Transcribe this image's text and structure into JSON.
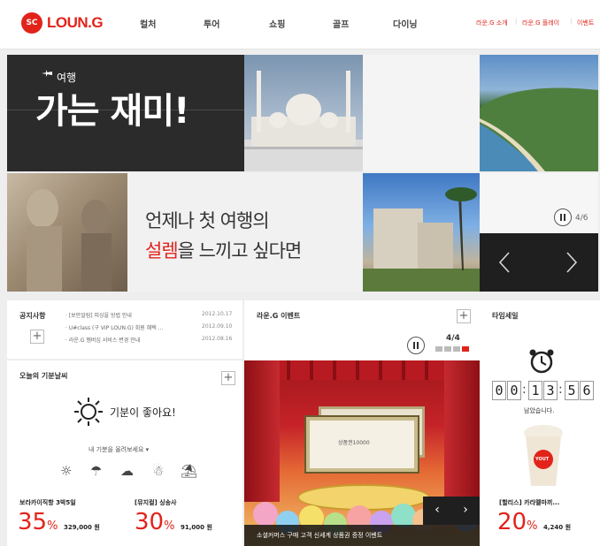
{
  "brand": {
    "logo_mark": "SC",
    "logo_text": "LOUN.G",
    "accent": "#e2231a"
  },
  "nav": [
    "컬처",
    "투어",
    "쇼핑",
    "골프",
    "다이닝"
  ],
  "util_links": [
    "라운.G 소개",
    "라운.G 플레이",
    "이벤트"
  ],
  "hero": {
    "travel_label": "여행",
    "headline": "가는 재미!",
    "line1": "언제나 첫 여행의",
    "line2_accent": "설렘",
    "line2_rest": "을 느끼고 싶다면",
    "counter": "4/6"
  },
  "notice": {
    "title": "공지사항",
    "items": [
      {
        "text": "· [보안알림] 피싱을 방법 안내",
        "date": "2012.10.17"
      },
      {
        "text": "· U#class (구 VIP LOUN.G) 회원 혜택 ...",
        "date": "2012.09.10"
      },
      {
        "text": "· 라운.G 멤버십 서비스 변경 안내",
        "date": "2012.08.16"
      }
    ]
  },
  "event": {
    "title": "라운.G 이벤트",
    "counter": "4/4",
    "ticket_text": "상품권10000",
    "caption": "소셜커머스 구매 고객 신세계 상품권 증정 이벤트"
  },
  "timesale": {
    "title": "타임세일",
    "digits": [
      "0",
      "0",
      "1",
      "3",
      "5",
      "6"
    ],
    "remain": "남았습니다.",
    "product_label": "YOUT",
    "deal_name": "[할리스] 카라멜마끼...",
    "deal_pct": "20",
    "deal_price": "4,240 원"
  },
  "mood": {
    "title": "오늘의 기분날씨",
    "message": "기분이 좋아요!",
    "prompt": "내 기분을 올려보세요 ▾",
    "icons": [
      "sun-icon",
      "umbrella-icon",
      "cloud-icon",
      "snowman-icon",
      "no-umbrella-icon"
    ],
    "deals": [
      {
        "name": "보라카이직항 3박5일",
        "pct": "35",
        "price": "329,000 원"
      },
      {
        "name": "[뮤지컬] 싱송사",
        "pct": "30",
        "price": "91,000 원"
      }
    ]
  }
}
